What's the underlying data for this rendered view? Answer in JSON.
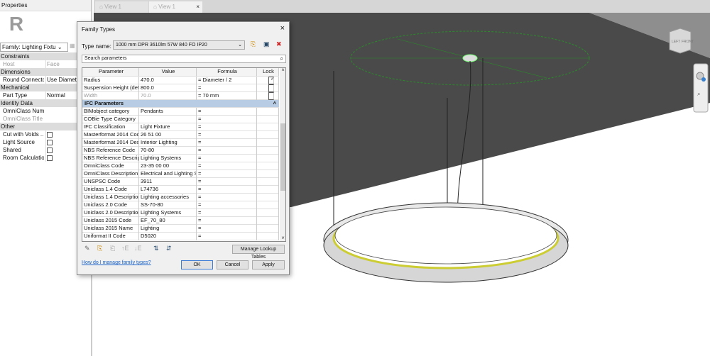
{
  "properties": {
    "title": "Properties",
    "logo": "R",
    "family_selector": "Family: Lighting Fixtu",
    "edit_type": "Edit",
    "rows": [
      {
        "type": "group",
        "label": "Constraints"
      },
      {
        "type": "prop",
        "label": "Host",
        "value": "Face",
        "dim": true
      },
      {
        "type": "group",
        "label": "Dimensions"
      },
      {
        "type": "prop",
        "label": "Round Connecto...",
        "value": "Use Diameter"
      },
      {
        "type": "group",
        "label": "Mechanical"
      },
      {
        "type": "prop",
        "label": "Part Type",
        "value": "Normal"
      },
      {
        "type": "group",
        "label": "Identity Data"
      },
      {
        "type": "prop",
        "label": "OmniClass Num...",
        "value": ""
      },
      {
        "type": "prop",
        "label": "OmniClass Title",
        "value": "",
        "dim": true
      },
      {
        "type": "group",
        "label": "Other"
      },
      {
        "type": "check",
        "label": "Cut with Voids ..."
      },
      {
        "type": "check",
        "label": "Light Source"
      },
      {
        "type": "check",
        "label": "Shared"
      },
      {
        "type": "check",
        "label": "Room Calculatio..."
      }
    ]
  },
  "tabs": [
    {
      "label": "View 1"
    },
    {
      "label": "View 1",
      "close": "×"
    }
  ],
  "viewcube": {
    "left": "LEFT",
    "front": "FRONT"
  },
  "dialog": {
    "title": "Family Types",
    "close": "×",
    "type_name_label": "Type name:",
    "type_name": "1000 mm DPR 3610lm 57W 840 FO IP20",
    "search_placeholder": "Search parameters",
    "headers": [
      "Parameter",
      "Value",
      "Formula",
      "Lock"
    ],
    "rows": [
      {
        "p": "Radius",
        "v": "470.0",
        "f": "= Diameter / 2",
        "lock": true
      },
      {
        "p": "Suspension Height (defa",
        "v": "800.0",
        "f": "=",
        "lock": false
      },
      {
        "p": "Width",
        "v": "70.0",
        "f": "= 70 mm",
        "lock": false,
        "dim": true
      }
    ],
    "section": "IFC Parameters",
    "ifc_rows": [
      {
        "p": "BIMobject category",
        "v": "Pendants",
        "f": "="
      },
      {
        "p": "COBie Type Category",
        "v": "",
        "f": "="
      },
      {
        "p": "IFC Classification",
        "v": "Light Fixture",
        "f": "="
      },
      {
        "p": "Masterformat 2014 Cod",
        "v": "26 51 00",
        "f": "="
      },
      {
        "p": "Masterformat 2014 Desc",
        "v": "Interior Lighting",
        "f": "="
      },
      {
        "p": "NBS Reference Code",
        "v": "70-80",
        "f": "="
      },
      {
        "p": "NBS Reference Descripti",
        "v": "Lighting Systems",
        "f": "="
      },
      {
        "p": "OmniClass Code",
        "v": "23-35 00 00",
        "f": "="
      },
      {
        "p": "OmniClass Description",
        "v": "Electrical and Lighting S",
        "f": "="
      },
      {
        "p": "UNSPSC Code",
        "v": "3911",
        "f": "="
      },
      {
        "p": "Uniclass 1.4 Code",
        "v": "L74736",
        "f": "="
      },
      {
        "p": "Uniclass 1.4 Description",
        "v": "Lighting accessories",
        "f": "="
      },
      {
        "p": "Uniclass 2.0 Code",
        "v": "SS-70-80",
        "f": "="
      },
      {
        "p": "Uniclass 2.0 Description",
        "v": "Lighting Systems",
        "f": "="
      },
      {
        "p": "Uniclass 2015 Code",
        "v": "EF_70_80",
        "f": "="
      },
      {
        "p": "Uniclass 2015 Name",
        "v": "Lighting",
        "f": "="
      },
      {
        "p": "Uniformat II Code",
        "v": "D5020",
        "f": "="
      }
    ],
    "manage_lookup": "Manage Lookup Tables",
    "help_link": "How do I manage family types?",
    "ok": "OK",
    "cancel": "Cancel",
    "apply": "Apply"
  }
}
